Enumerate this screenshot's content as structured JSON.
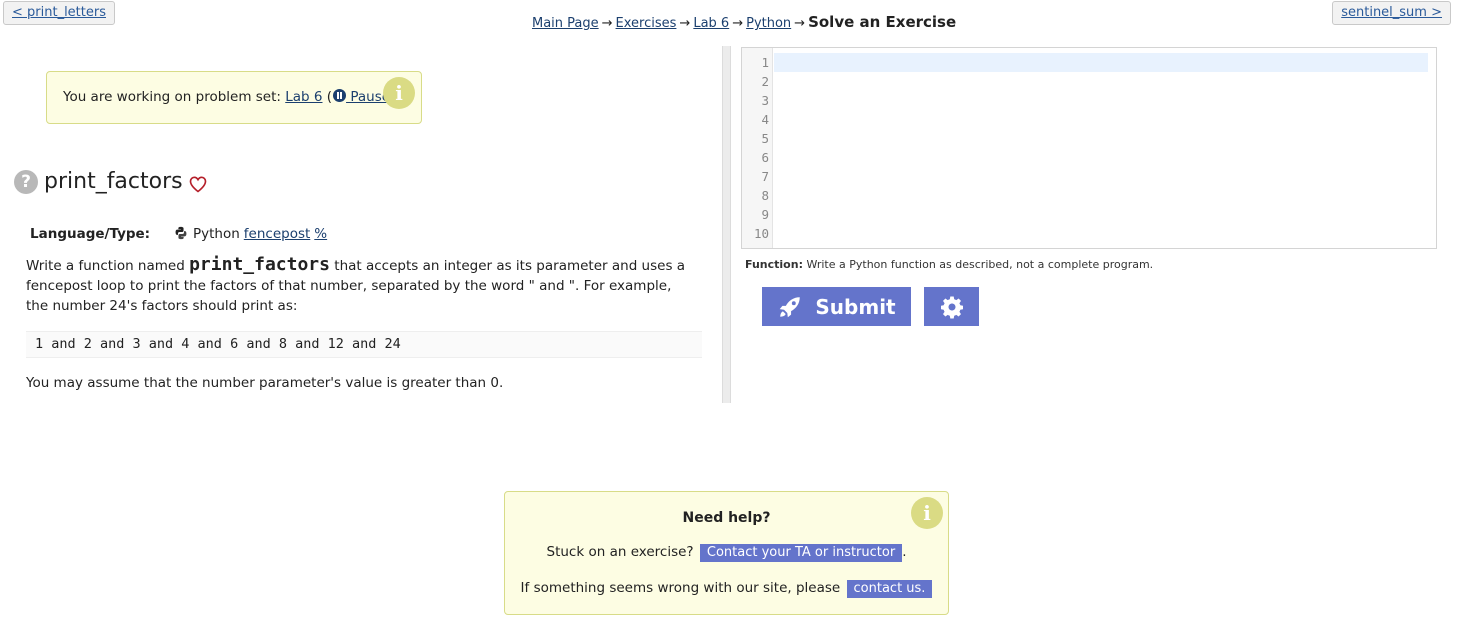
{
  "nav": {
    "prev_label": "< print_letters",
    "next_label": "sentinel_sum >"
  },
  "breadcrumb": {
    "items": [
      "Main Page",
      "Exercises",
      "Lab 6",
      "Python"
    ],
    "current": "Solve an Exercise",
    "separator": "→"
  },
  "problem_set": {
    "prefix": "You are working on problem set: ",
    "set_name": "Lab 6",
    "open_paren": " (",
    "pause_label": " Pause",
    "close_paren": ")",
    "info_glyph": "i"
  },
  "exercise": {
    "help_glyph": "?",
    "title": "print_factors",
    "language_label": "Language/Type:",
    "language": "Python",
    "tags": [
      "fencepost",
      "%"
    ],
    "desc_part1": "Write a function named ",
    "function_name": "print_factors",
    "desc_part2": " that accepts an integer as its parameter and uses a fencepost loop to print the factors of that number, separated by the word \" and \". For example, the number 24's factors should print as:",
    "sample_output": "1 and 2 and 3 and 4 and 6 and 8 and 12 and 24",
    "assumption": "You may assume that the number parameter's value is greater than 0."
  },
  "editor": {
    "line_numbers": [
      "1",
      "2",
      "3",
      "4",
      "5",
      "6",
      "7",
      "8",
      "9",
      "10"
    ],
    "hint_label": "Function:",
    "hint_text": " Write a Python function as described, not a complete program."
  },
  "actions": {
    "submit_label": "Submit"
  },
  "help": {
    "title": "Need help?",
    "line1_text": "Stuck on an exercise? ",
    "line1_button": "Contact your TA or instructor",
    "line1_after": ".",
    "line2_text": "If something seems wrong with our site, please ",
    "line2_button": "contact us.",
    "info_glyph": "i"
  },
  "colors": {
    "accent": "#6474cb",
    "notice_bg": "#fdfde3",
    "notice_border": "#d8dc88",
    "heart": "#b51f2a"
  }
}
